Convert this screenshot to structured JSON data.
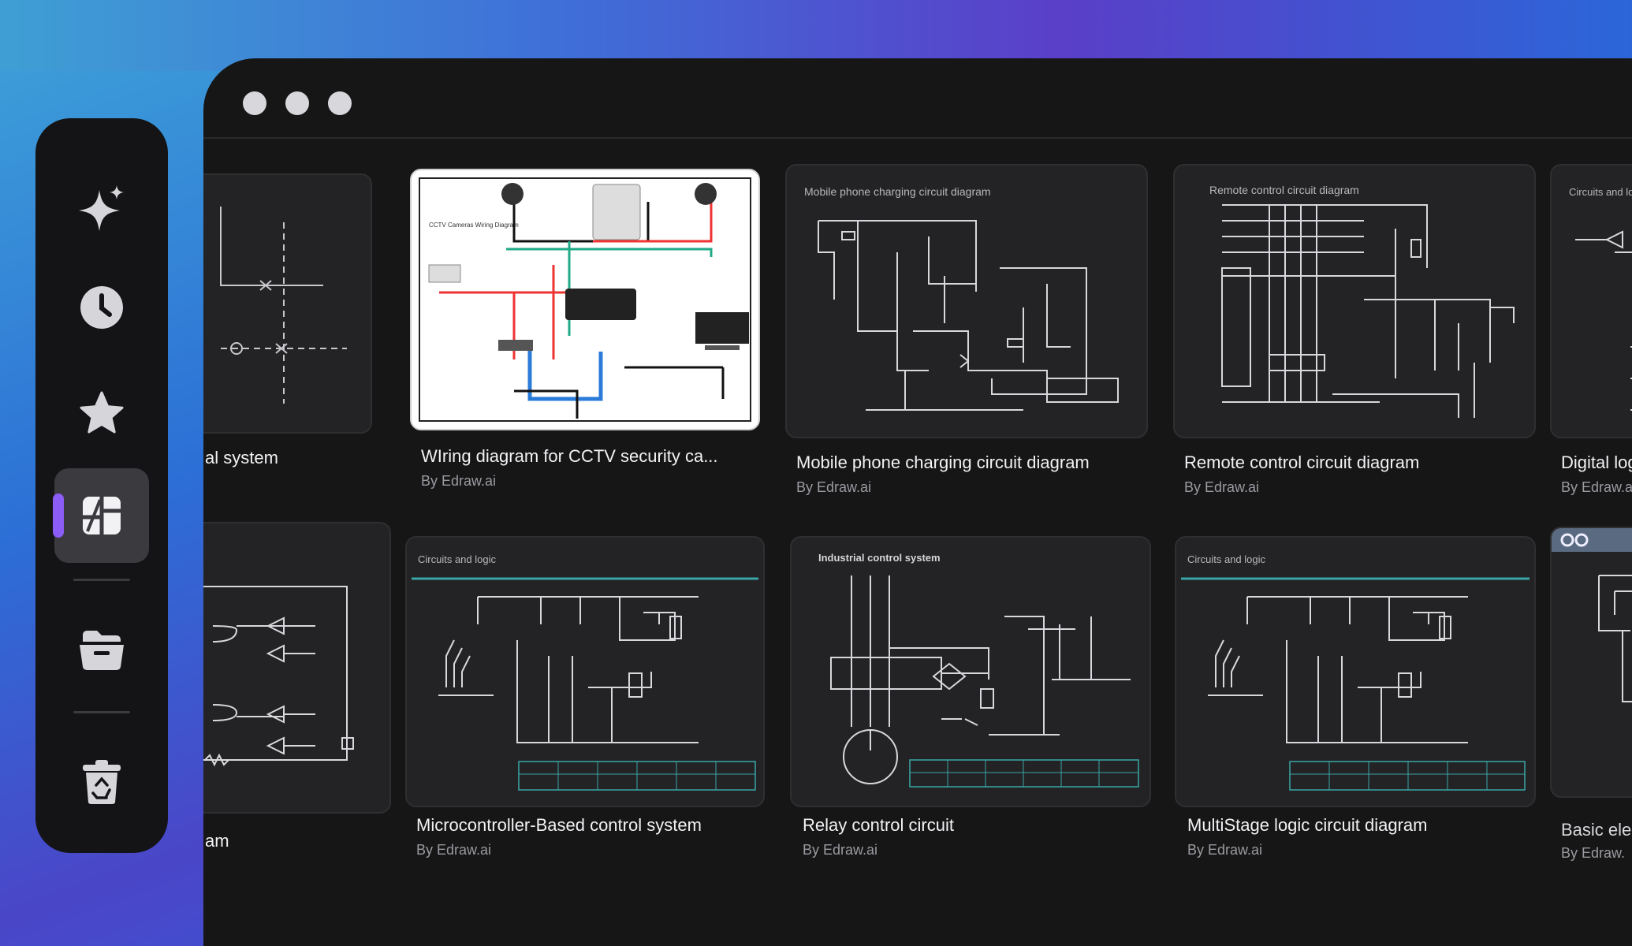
{
  "sidebar": {
    "items": [
      {
        "icon": "sparkle-icon"
      },
      {
        "icon": "clock-icon"
      },
      {
        "icon": "star-icon"
      },
      {
        "icon": "templates-icon",
        "active": true
      },
      {
        "icon": "folder-icon"
      },
      {
        "icon": "trash-icon"
      }
    ],
    "accent": "#8b5cf6"
  },
  "window": {
    "controls": [
      "dot",
      "dot",
      "dot"
    ]
  },
  "cards": [
    {
      "title": "al system",
      "author": "",
      "thumb_label": ""
    },
    {
      "title": "WIring diagram for CCTV security ca...",
      "author": "By Edraw.ai",
      "thumb_label": "CCTV Cameras Wiring Diagram"
    },
    {
      "title": "Mobile phone charging circuit diagram",
      "author": "By Edraw.ai",
      "thumb_label": "Mobile phone charging circuit diagram"
    },
    {
      "title": "Remote control circuit diagram",
      "author": "By Edraw.ai",
      "thumb_label": "Remote control circuit diagram"
    },
    {
      "title": "Digital log",
      "author": "By Edraw.a",
      "thumb_label": "Circuits and lo"
    },
    {
      "title": "am",
      "author": "",
      "thumb_label": ""
    },
    {
      "title": "Microcontroller-Based control system",
      "author": "By Edraw.ai",
      "thumb_label": "Circuits and logic"
    },
    {
      "title": "Relay control circuit",
      "author": "By Edraw.ai",
      "thumb_label": "Industrial control system"
    },
    {
      "title": "MultiStage logic circuit diagram",
      "author": "By Edraw.ai",
      "thumb_label": "Circuits and logic"
    },
    {
      "title": "Basic ele",
      "author": "By Edraw.",
      "thumb_label": ""
    }
  ],
  "colors": {
    "window_bg": "#161617",
    "card_bg": "#232325",
    "accent_teal": "#3aa6a6"
  }
}
